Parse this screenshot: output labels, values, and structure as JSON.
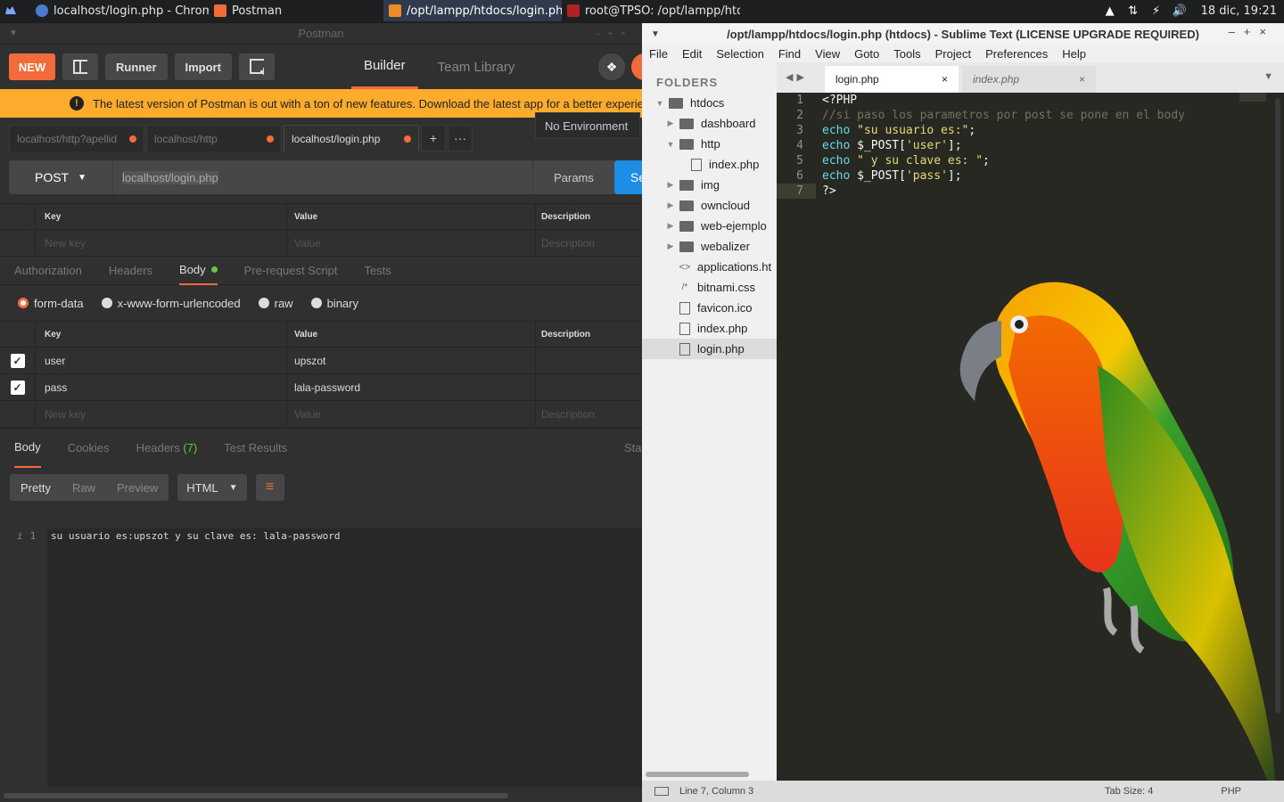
{
  "taskbar": {
    "tasks": [
      {
        "label": "localhost/login.php - Chromi..."
      },
      {
        "label": "Postman"
      },
      {
        "label": "/opt/lampp/htdocs/login.php ..."
      },
      {
        "label": "root@TPSO: /opt/lampp/htdo..."
      }
    ],
    "clock": "18 dic, 19:21"
  },
  "postman": {
    "title": "Postman",
    "toolbar": {
      "new": "NEW",
      "runner": "Runner",
      "import": "Import",
      "builder": "Builder",
      "team_library": "Team Library"
    },
    "banner": "The latest version of Postman is out with a ton of new features. Download the latest app for a better experien",
    "tabs": [
      "localhost/http?apellid",
      "localhost/http",
      "localhost/login.php"
    ],
    "environment": "No Environment",
    "request": {
      "method": "POST",
      "url": "localhost/login.php",
      "params": "Params",
      "send": "Se"
    },
    "params_table": {
      "key": "Key",
      "value": "Value",
      "description": "Description",
      "ph_key": "New key",
      "ph_value": "Value",
      "ph_desc": "Description"
    },
    "req_tabs": [
      "Authorization",
      "Headers",
      "Body",
      "Pre-request Script",
      "Tests"
    ],
    "body_modes": [
      "form-data",
      "x-www-form-urlencoded",
      "raw",
      "binary"
    ],
    "body_table": {
      "key": "Key",
      "value": "Value",
      "description": "Description",
      "rows": [
        {
          "key": "user",
          "value": "upszot"
        },
        {
          "key": "pass",
          "value": "lala-password"
        }
      ],
      "ph_key": "New key",
      "ph_value": "Value",
      "ph_desc": "Description"
    },
    "response": {
      "tabs": [
        "Body",
        "Cookies",
        "Headers",
        "(7)",
        "Test Results",
        "Stat"
      ],
      "views": [
        "Pretty",
        "Raw",
        "Preview"
      ],
      "format": "HTML",
      "line_no": "1",
      "line_marker": "i",
      "output": "su usuario es:upszot y su clave es: lala-password"
    }
  },
  "sublime": {
    "title": "/opt/lampp/htdocs/login.php (htdocs) - Sublime Text (LICENSE UPGRADE REQUIRED)",
    "menu": [
      "File",
      "Edit",
      "Selection",
      "Find",
      "View",
      "Goto",
      "Tools",
      "Project",
      "Preferences",
      "Help"
    ],
    "sidebar": {
      "header": "FOLDERS",
      "items": [
        "htdocs",
        "dashboard",
        "http",
        "index.php",
        "img",
        "owncloud",
        "web-ejemplo",
        "webalizer",
        "applications.ht",
        "bitnami.css",
        "favicon.ico",
        "index.php",
        "login.php"
      ]
    },
    "tabs": [
      "login.php",
      "index.php"
    ],
    "code": {
      "line_numbers": [
        "1",
        "2",
        "3",
        "4",
        "5",
        "6",
        "7"
      ],
      "l1": "<?PHP",
      "l2": "//si paso los parametros por post se pone en el body",
      "l3_kw": "echo",
      "l3_str": "\"su usuario es:\"",
      "l3_end": ";",
      "l4_kw": "echo",
      "l4_a": "$_POST[",
      "l4_str": "'user'",
      "l4_end": "];",
      "l5_kw": "echo",
      "l5_str": "\" y su clave es: \"",
      "l5_end": ";",
      "l6_kw": "echo",
      "l6_a": "$_POST[",
      "l6_str": "'pass'",
      "l6_end": "];",
      "l7": "?>"
    },
    "status": {
      "position": "Line 7, Column 3",
      "tab_size": "Tab Size: 4",
      "syntax": "PHP"
    }
  },
  "colors": {
    "postman_accent": "#f26b3a",
    "banner": "#fcab2d",
    "send": "#1e8de5",
    "sublime_bg": "#272822"
  }
}
